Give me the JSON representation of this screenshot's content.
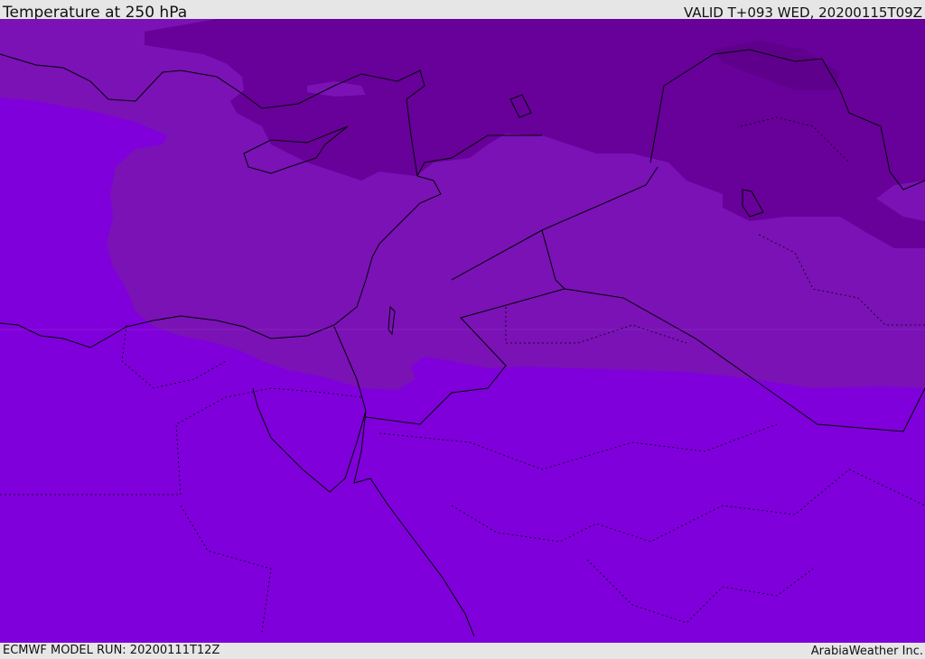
{
  "header": {
    "title": "Temperature at 250 hPa",
    "valid": "VALID T+093 WED, 20200115T09Z"
  },
  "footer": {
    "model_run": "ECMWF MODEL RUN: 20200111T12Z",
    "credit": "ArabiaWeather Inc."
  },
  "colors": {
    "band_warm": "#7f00db",
    "band_mid": "#7a12b6",
    "band_cold": "#68009a",
    "band_coldest": "#5e008c",
    "coast": "#000000",
    "frame": "#e6e6e6"
  }
}
